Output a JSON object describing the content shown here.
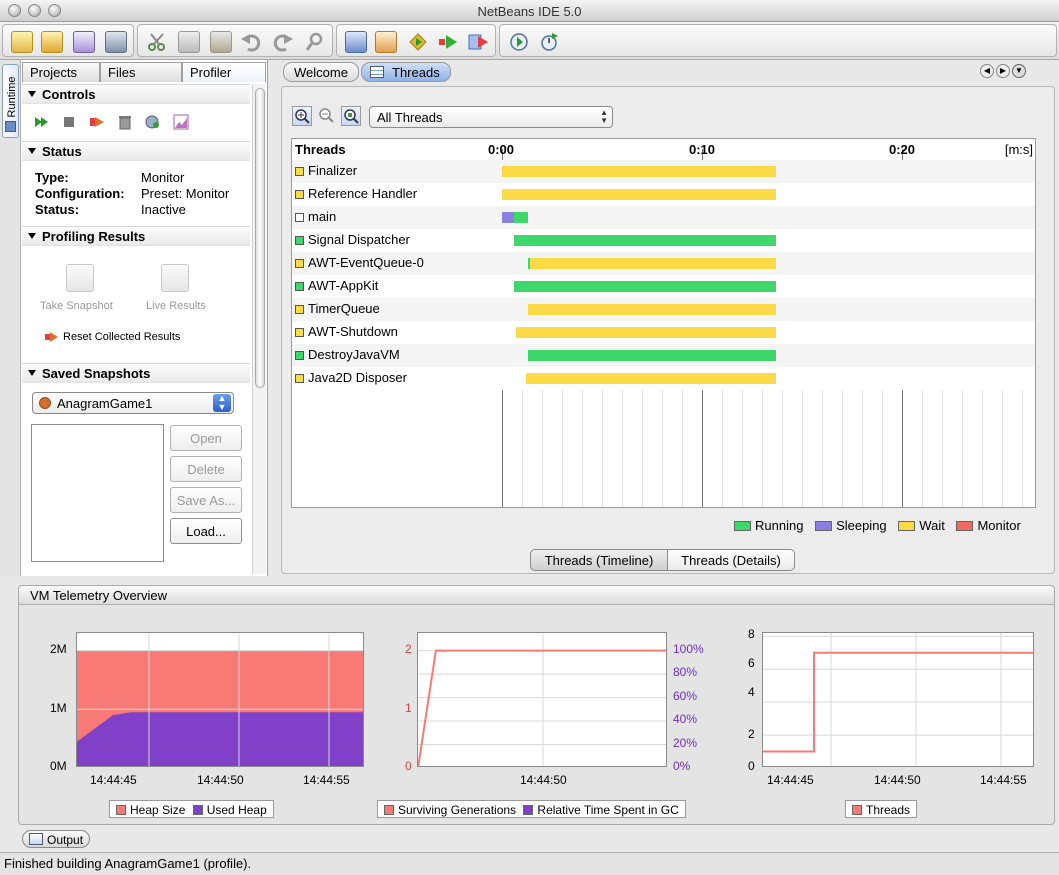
{
  "window": {
    "title": "NetBeans IDE 5.0"
  },
  "left_panel": {
    "side_tab": "Runtime",
    "tabs": [
      "Projects",
      "Files",
      "Profiler"
    ],
    "controls": {
      "header": "Controls"
    },
    "status": {
      "header": "Status",
      "rows": [
        {
          "key": "Type:",
          "value": "Monitor"
        },
        {
          "key": "Configuration:",
          "value": "Preset: Monitor"
        },
        {
          "key": "Status:",
          "value": "Inactive"
        }
      ]
    },
    "profiling_results": {
      "header": "Profiling Results",
      "take_snapshot": "Take Snapshot",
      "live_results": "Live Results",
      "reset": "Reset Collected Results"
    },
    "saved_snapshots": {
      "header": "Saved Snapshots",
      "project": "AnagramGame1",
      "buttons": {
        "open": "Open",
        "delete": "Delete",
        "save_as": "Save As...",
        "load": "Load..."
      }
    }
  },
  "editor": {
    "tabs": [
      "Welcome",
      "Threads"
    ],
    "filter": "All Threads",
    "timeline": {
      "header": "Threads",
      "ticks": [
        "0:00",
        "0:10",
        "0:20"
      ],
      "unit": "[m:s]",
      "threads": [
        {
          "name": "Finalizer",
          "state": "wait",
          "segments": [
            {
              "state": "wait",
              "start": 0.0,
              "end": 13.7
            }
          ]
        },
        {
          "name": "Reference Handler",
          "state": "wait",
          "segments": [
            {
              "state": "wait",
              "start": 0.0,
              "end": 13.7
            }
          ]
        },
        {
          "name": "main",
          "state": "none",
          "segments": [
            {
              "state": "sleeping",
              "start": 0.0,
              "end": 0.6
            },
            {
              "state": "running",
              "start": 0.6,
              "end": 1.3
            }
          ]
        },
        {
          "name": "Signal Dispatcher",
          "state": "running",
          "segments": [
            {
              "state": "running",
              "start": 0.6,
              "end": 13.7
            }
          ]
        },
        {
          "name": "AWT-EventQueue-0",
          "state": "wait",
          "segments": [
            {
              "state": "running",
              "start": 1.3,
              "end": 1.4
            },
            {
              "state": "wait",
              "start": 1.4,
              "end": 13.7
            }
          ]
        },
        {
          "name": "AWT-AppKit",
          "state": "running",
          "segments": [
            {
              "state": "running",
              "start": 0.6,
              "end": 13.7
            }
          ]
        },
        {
          "name": "TimerQueue",
          "state": "wait",
          "segments": [
            {
              "state": "wait",
              "start": 1.3,
              "end": 13.7
            }
          ]
        },
        {
          "name": "AWT-Shutdown",
          "state": "wait",
          "segments": [
            {
              "state": "wait",
              "start": 0.7,
              "end": 13.7
            }
          ]
        },
        {
          "name": "DestroyJavaVM",
          "state": "running",
          "segments": [
            {
              "state": "running",
              "start": 1.3,
              "end": 13.7
            }
          ]
        },
        {
          "name": "Java2D Disposer",
          "state": "wait",
          "segments": [
            {
              "state": "wait",
              "start": 1.2,
              "end": 13.7
            }
          ]
        }
      ],
      "legend": [
        "Running",
        "Sleeping",
        "Wait",
        "Monitor"
      ]
    },
    "bottom_tabs": [
      "Threads (Timeline)",
      "Threads (Details)"
    ]
  },
  "colors": {
    "running": "#3ed86a",
    "sleeping": "#8b7fe0",
    "wait": "#fadb45",
    "monitor": "#f06a63",
    "heap": "#f87a76",
    "used_heap": "#8040c8",
    "none": "#ffffff"
  },
  "telemetry": {
    "title": "VM Telemetry Overview",
    "charts": [
      {
        "type": "area",
        "y_ticks": [
          "2M",
          "1M",
          "0M"
        ],
        "x_ticks": [
          "14:44:45",
          "14:44:50",
          "14:44:55"
        ],
        "legend": [
          "Heap Size",
          "Used Heap"
        ]
      },
      {
        "type": "line",
        "y_ticks_left": [
          "2",
          "1",
          "0"
        ],
        "y_ticks_right": [
          "100%",
          "80%",
          "60%",
          "40%",
          "20%",
          "0%"
        ],
        "x_ticks": [
          "14:44:50"
        ],
        "legend": [
          "Surviving Generations",
          "Relative Time Spent in GC"
        ]
      },
      {
        "type": "line",
        "y_ticks": [
          "8",
          "6",
          "4",
          "2",
          "0"
        ],
        "x_ticks": [
          "14:44:45",
          "14:44:50",
          "14:44:55"
        ],
        "legend": [
          "Threads"
        ]
      }
    ]
  },
  "chart_data": [
    {
      "type": "area",
      "x": [
        "14:44:41",
        "14:44:43",
        "14:44:44",
        "14:44:57"
      ],
      "series": [
        {
          "name": "Heap Size",
          "values": [
            2.0,
            2.0,
            2.0,
            2.0
          ]
        },
        {
          "name": "Used Heap",
          "values": [
            0.45,
            0.9,
            0.95,
            0.95
          ]
        }
      ],
      "ylim": [
        0,
        2
      ]
    },
    {
      "type": "line",
      "x": [
        "14:44:43",
        "14:44:44",
        "14:44:57"
      ],
      "series": [
        {
          "name": "Surviving Generations",
          "values": [
            0,
            2,
            2
          ]
        },
        {
          "name": "Relative Time Spent in GC",
          "values": [
            0,
            0,
            0
          ]
        }
      ],
      "ylim": [
        0,
        2
      ]
    },
    {
      "type": "line",
      "x": [
        "14:44:41",
        "14:44:44",
        "14:44:44",
        "14:44:57"
      ],
      "series": [
        {
          "name": "Threads",
          "values": [
            1,
            1,
            7,
            7
          ]
        }
      ],
      "ylim": [
        0,
        8
      ]
    }
  ],
  "output_tab": "Output",
  "status_bar": "Finished building AnagramGame1 (profile)."
}
